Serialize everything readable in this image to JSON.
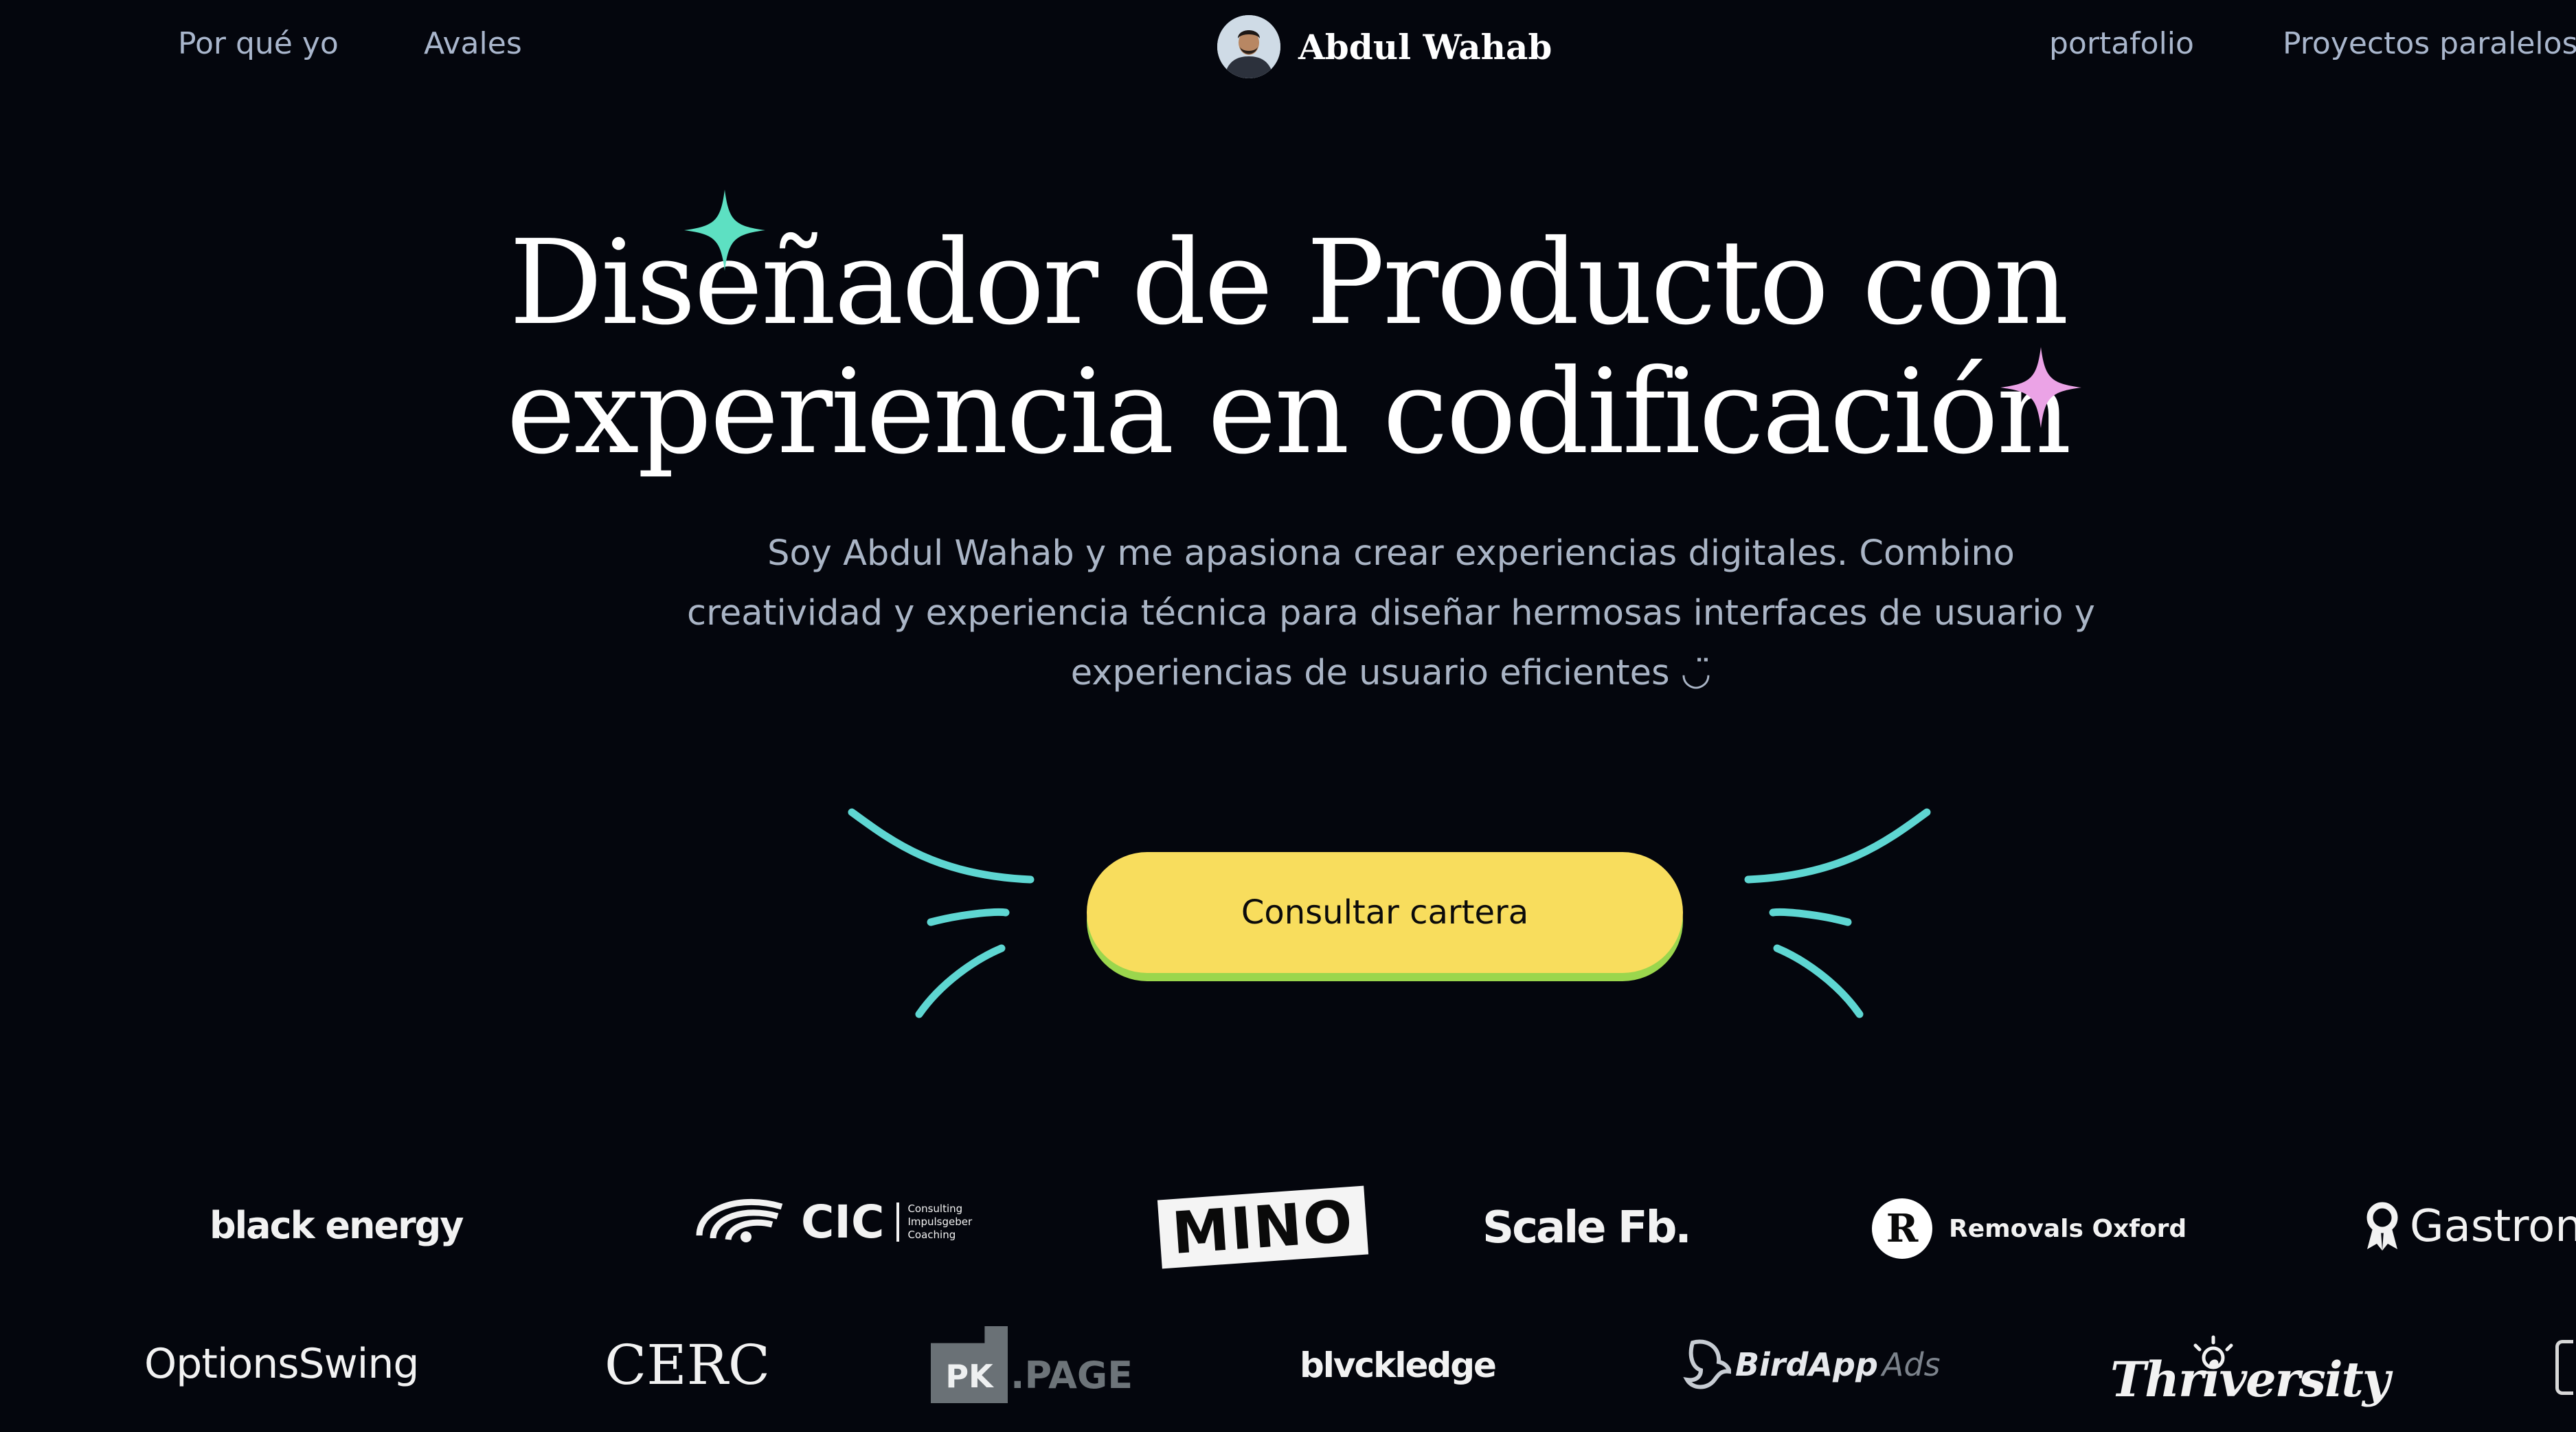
{
  "nav": {
    "left": [
      "Por qué yo",
      "Avales"
    ],
    "right": [
      "portafolio",
      "Proyectos paralelos"
    ],
    "brand_name": "Abdul Wahab"
  },
  "hero": {
    "title_line1": "Diseñador de Producto con",
    "title_line2": "experiencia en codificación",
    "subtitle": "Soy Abdul Wahab y me apasiona crear experiencias digitales. Combino creatividad y experiencia técnica para diseñar hermosas interfaces de usuario y experiencias de usuario eficientes ◡̈",
    "cta_label": "Consultar cartera"
  },
  "logos_row1": {
    "black_energy": "black energy",
    "cic": "CIC",
    "cic_tagline": [
      "Consulting",
      "Impulsgeber",
      "Coaching"
    ],
    "mino": "MINO",
    "scale_fb": "Scale Fb.",
    "removals_mark": "R",
    "removals_oxford": "Removals Oxford",
    "gastron": "Gastron"
  },
  "logos_row2": {
    "options_swing": "OptionsSwing",
    "cerc": "CERC",
    "pk_mark": "PK",
    "pk_word": ".PAGE",
    "blvckledge": "blvckledge",
    "bird_app": "BirdApp",
    "bird_ads": "Ads",
    "thriversity": "Thriversity"
  },
  "colors": {
    "background": "#04060d",
    "nav_text": "#a9b6cc",
    "cta_fill": "#f8dd5d",
    "cta_shadow": "#9bd64d",
    "sparkle_teal": "#5de0c2",
    "sparkle_pink": "#eba3e6",
    "whisker": "#5ed6d2"
  },
  "icons": [
    "avatar-photo",
    "sparkle-icon",
    "whisker-lines"
  ]
}
